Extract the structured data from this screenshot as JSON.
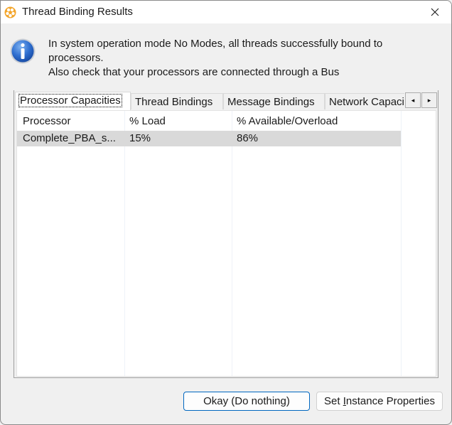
{
  "window": {
    "title": "Thread Binding Results",
    "app_icon": "java-app-icon",
    "close_icon": "close-icon"
  },
  "message": {
    "icon": "info-icon",
    "line1": "In system operation mode No Modes, all threads successfully bound to processors.",
    "line2": "Also check that your processors are connected through a Bus"
  },
  "tabs": [
    {
      "label": "Processor Capacities",
      "active": true
    },
    {
      "label": "Thread Bindings",
      "active": false
    },
    {
      "label": "Message Bindings",
      "active": false
    },
    {
      "label": "Network Capacities",
      "active": false
    }
  ],
  "tab_scroll": {
    "left": "◂",
    "right": "▸"
  },
  "table": {
    "columns": [
      "Processor",
      "% Load",
      "% Available/Overload"
    ],
    "rows": [
      [
        "Complete_PBA_s...",
        "15%",
        "86%"
      ]
    ]
  },
  "buttons": {
    "okay": "Okay (Do nothing)",
    "set_pre": "Set ",
    "set_u": "I",
    "set_post": "nstance Properties"
  }
}
